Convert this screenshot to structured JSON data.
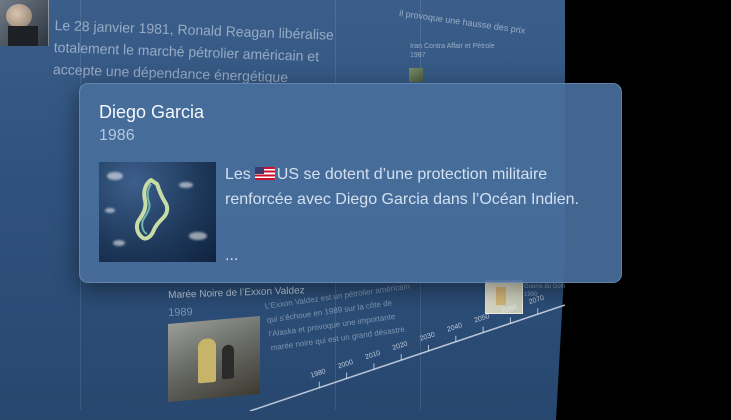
{
  "popup": {
    "title": "Diego Garcia",
    "year": "1986",
    "description_pre": "Les",
    "flag_icon": "us-flag-icon",
    "description_post": "US se dotent d’une protection militaire renforcée avec Diego Garcia dans l’Océan Indien.",
    "ellipsis": "..."
  },
  "background": {
    "reagan_text_lines": [
      "Le 28 janvier 1981, Ronald Reagan libéralise",
      "totalement le marché pétrolier américain et",
      "accepte une dépendance énergétique"
    ],
    "top_right_text": "il provoque une hausse des prix",
    "small_card_title": [
      "Iran Contra Affair et Pétrole",
      "1987"
    ],
    "event_card": {
      "title": "Marée Noire de l’Exxon Valdez",
      "year": "1989",
      "text_lines": [
        "L’Exxon Valdez est un pétrolier américain",
        "qui s’échoue en 1989 sur la côte de",
        "l’Alaska et provoque une importante",
        "marée noire qui est un grand désastre."
      ]
    },
    "map_text": [
      "Guerre du Golfe",
      "1990"
    ],
    "timeline_ticks": [
      "1980",
      "2000",
      "2010",
      "2020",
      "2030",
      "2040",
      "2050",
      "2060",
      "2070"
    ]
  },
  "colors": {
    "wall": "#2f527d",
    "popup": "#486e9c",
    "title": "#f4f8fc",
    "year": "#b5c8de",
    "text": "#d3e0ef"
  }
}
